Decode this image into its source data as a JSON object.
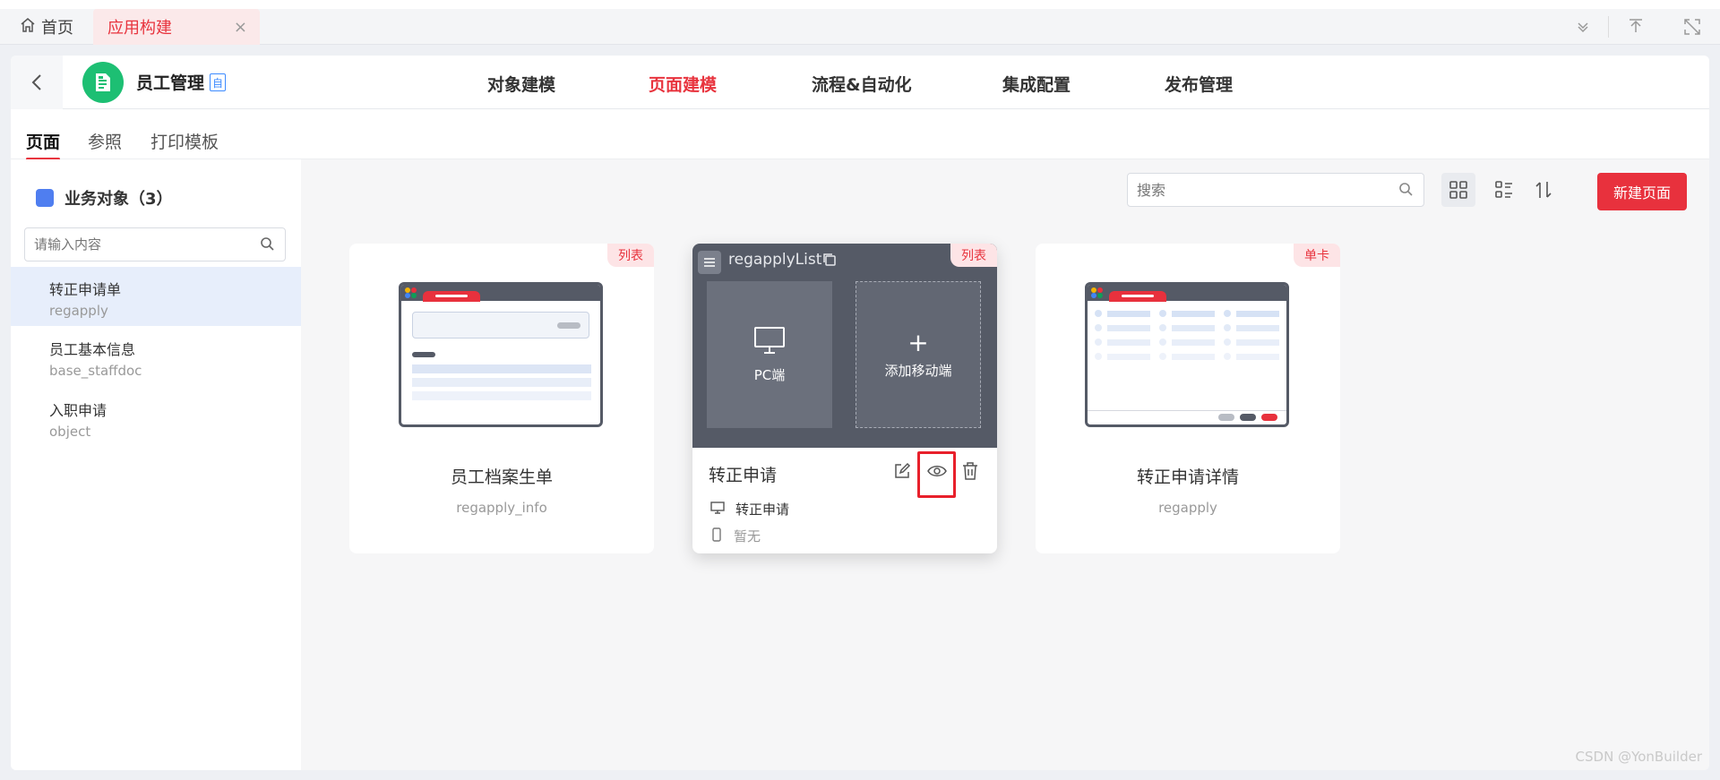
{
  "tabs": {
    "home": "首页",
    "active": "应用构建",
    "close": "×"
  },
  "app": {
    "name": "员工管理",
    "badge": "自"
  },
  "nav": [
    "对象建模",
    "页面建模",
    "流程&自动化",
    "集成配置",
    "发布管理"
  ],
  "subtabs": [
    "页面",
    "参照",
    "打印模板"
  ],
  "sidebar": {
    "title": "业务对象（3）",
    "search_placeholder": "请输入内容",
    "items": [
      {
        "title": "转正申请单",
        "sub": "regapply"
      },
      {
        "title": "员工基本信息",
        "sub": "base_staffdoc"
      },
      {
        "title": "入职申请",
        "sub": "object"
      }
    ]
  },
  "content": {
    "search_placeholder": "搜索",
    "new_button": "新建页面"
  },
  "cards": [
    {
      "badge": "列表",
      "name": "员工档案生单",
      "code": "regapply_info"
    },
    {
      "badge": "列表",
      "title": "regapplyList",
      "pc_label": "PC端",
      "mobile_label": "添加移动端",
      "plus": "+",
      "name": "转正申请",
      "pc_value": "转正申请",
      "mobile_value": "暂无"
    },
    {
      "badge": "单卡",
      "name": "转正申请详情",
      "code": "regapply"
    }
  ],
  "watermark": "CSDN @YonBuilder",
  "colors": {
    "accent": "#e8313d",
    "app_logo": "#1dbf73",
    "active_row": "#e7eefb"
  }
}
